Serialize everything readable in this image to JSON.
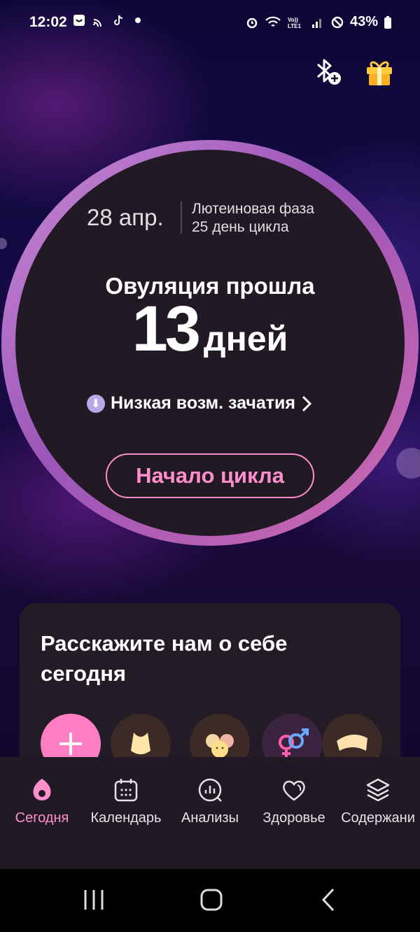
{
  "status_bar": {
    "time": "12:02",
    "battery": "43%"
  },
  "header_icons": {
    "bluetooth_add": "bluetooth-add-icon",
    "gift": "gift-icon"
  },
  "cycle": {
    "date": "28 апр.",
    "phase": "Лютеиновая фаза",
    "cycle_day": "25 день цикла",
    "headline": "Овуляция прошла",
    "days_number": "13",
    "days_unit": "дней",
    "chance_label": "Низкая возм. зачатия",
    "start_button": "Начало цикла"
  },
  "card": {
    "title": "Расскажите нам о себе сегодня"
  },
  "bottom_nav": {
    "items": [
      {
        "label": "Сегодня",
        "icon": "drop-icon",
        "active": true
      },
      {
        "label": "Календарь",
        "icon": "calendar-icon",
        "active": false
      },
      {
        "label": "Анализы",
        "icon": "chart-icon",
        "active": false
      },
      {
        "label": "Здоровье",
        "icon": "heart-icon",
        "active": false
      },
      {
        "label": "Содержани",
        "icon": "layers-icon",
        "active": false
      }
    ]
  },
  "colors": {
    "accent_pink": "#ff8fcc",
    "ring_purple": "#b06ac6",
    "card_bg": "#231b26"
  }
}
